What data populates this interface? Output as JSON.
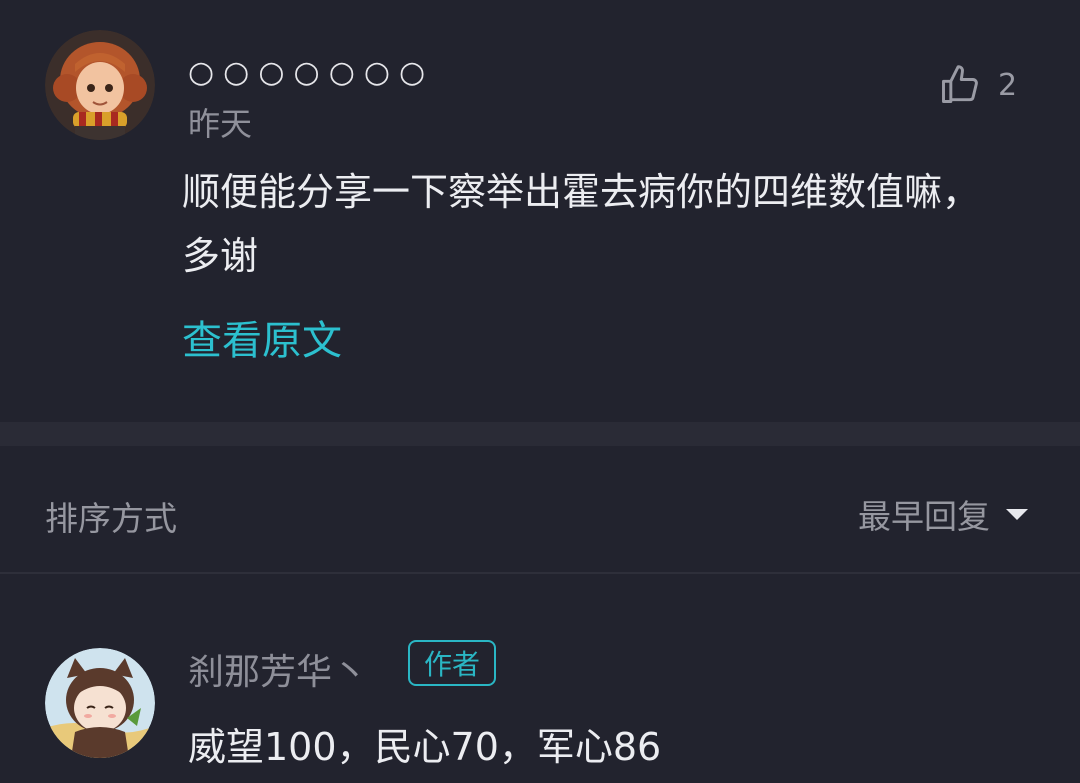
{
  "original_comment": {
    "username": "○○○○○○○",
    "time": "昨天",
    "like_count": "2",
    "text": "顺便能分享一下察举出霍去病你的四维数值嘛，多谢",
    "view_original_label": "查看原文"
  },
  "sort": {
    "label": "排序方式",
    "selected": "最早回复"
  },
  "reply": {
    "username": "刹那芳华丶",
    "badge": "作者",
    "text": "威望100，民心70，军心86"
  },
  "colors": {
    "background": "#22232e",
    "accent": "#2cc0cf",
    "primary_text": "#ecedf1",
    "secondary_text": "#9697a0"
  },
  "icons": {
    "like": "thumbs-up-icon",
    "dropdown": "caret-down-icon"
  }
}
